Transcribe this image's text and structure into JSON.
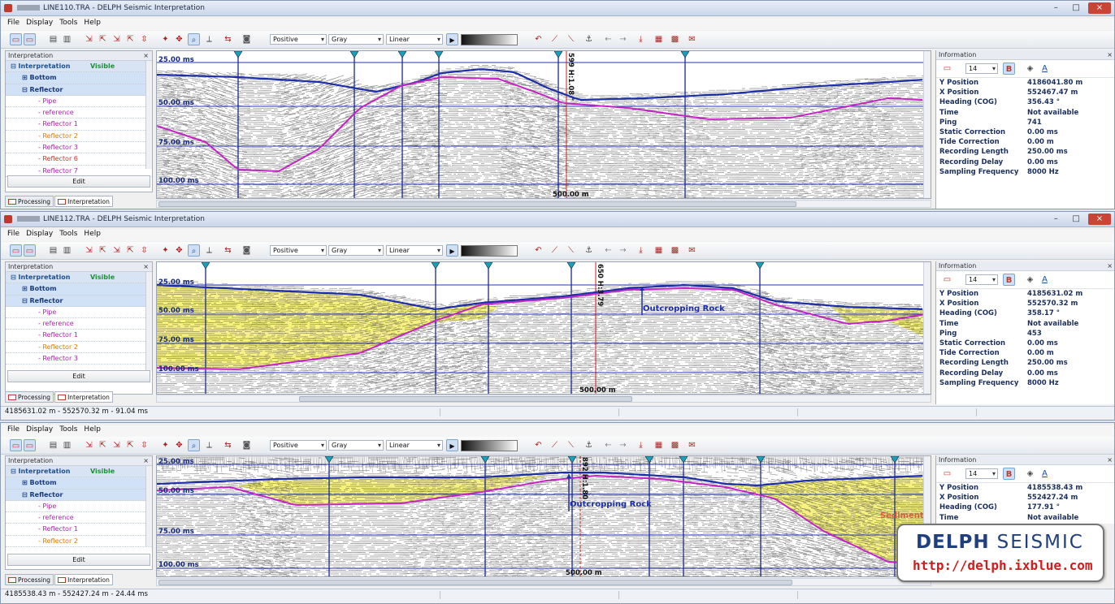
{
  "menu": [
    "File",
    "Display",
    "Tools",
    "Help"
  ],
  "toolbar_combos": {
    "polarity": "Positive",
    "palette": "Gray",
    "scale": "Linear"
  },
  "panel": {
    "interpretation_title": "Interpretation",
    "col_name": "Interpretation",
    "col_visible": "Visible",
    "edit_label": "Edit",
    "tab_processing": "Processing",
    "tab_interpretation": "Interpretation",
    "information_title": "Information",
    "font_size": "14",
    "info_bold": "B",
    "info_font_icon": "A",
    "close_glyph": "×"
  },
  "info_labels": [
    "Y Position",
    "X Position",
    "Heading (COG)",
    "Time",
    "Ping",
    "Static Correction",
    "Tide Correction",
    "Recording Length",
    "Recording Delay",
    "Sampling Frequency"
  ],
  "windows": [
    {
      "title": "LINE110.TRA - DELPH Seismic Interpretation",
      "tree": [
        {
          "label": "Bottom",
          "color": "#173a7a",
          "kind": "sel"
        },
        {
          "label": "Reflector",
          "color": "#173a7a",
          "kind": "sel"
        },
        {
          "label": "Pipe",
          "color": "#b01fb0"
        },
        {
          "label": "reference",
          "color": "#b01fb0"
        },
        {
          "label": "Reflector 1",
          "color": "#b01fb0"
        },
        {
          "label": "Reflector 2",
          "color": "#e07a00"
        },
        {
          "label": "Reflector 3",
          "color": "#b01fb0"
        },
        {
          "label": "Reflector 6",
          "color": "#c0392b"
        },
        {
          "label": "Reflector 7",
          "color": "#b01fb0"
        }
      ],
      "time_labels": [
        "25.00 ms",
        "50.00 ms",
        "75.00 ms",
        "100.00 ms"
      ],
      "distance_label": "500.00 m",
      "marker_label": "599 H:1.08 °",
      "info_values": [
        "4186041.80 m",
        "552467.47 m",
        "356.43 °",
        "Not available",
        "741",
        "0.00 ms",
        "0.00 m",
        "250.00 ms",
        "0.00 ms",
        "8000 Hz"
      ],
      "status": ""
    },
    {
      "title": "LINE112.TRA - DELPH Seismic Interpretation",
      "tree": [
        {
          "label": "Bottom",
          "color": "#173a7a",
          "kind": "sel"
        },
        {
          "label": "Reflector",
          "color": "#173a7a",
          "kind": "sel"
        },
        {
          "label": "Pipe",
          "color": "#b01fb0"
        },
        {
          "label": "reference",
          "color": "#b01fb0"
        },
        {
          "label": "Reflector 1",
          "color": "#b01fb0"
        },
        {
          "label": "Reflector 2",
          "color": "#e07a00"
        },
        {
          "label": "Reflector 3",
          "color": "#b01fb0"
        }
      ],
      "time_labels": [
        "25.00 ms",
        "50.00 ms",
        "75.00 ms",
        "100.00 ms"
      ],
      "distance_label": "500.00 m",
      "marker_label": "650 H:3.79",
      "annotation": "Outcropping Rock",
      "info_values": [
        "4185631.02 m",
        "552570.32 m",
        "358.17 °",
        "Not available",
        "453",
        "0.00 ms",
        "0.00 m",
        "250.00 ms",
        "0.00 ms",
        "8000 Hz"
      ],
      "status": "4185631.02 m - 552570.32 m - 91.04 ms"
    },
    {
      "title": "",
      "tree": [
        {
          "label": "Bottom",
          "color": "#173a7a",
          "kind": "sel"
        },
        {
          "label": "Reflector",
          "color": "#173a7a",
          "kind": "sel"
        },
        {
          "label": "Pipe",
          "color": "#b01fb0"
        },
        {
          "label": "reference",
          "color": "#b01fb0"
        },
        {
          "label": "Reflector 1",
          "color": "#b01fb0"
        },
        {
          "label": "Reflector 2",
          "color": "#e07a00"
        }
      ],
      "time_labels": [
        "25.00 ms",
        "50.00 ms",
        "75.00 ms",
        "100.00 ms"
      ],
      "distance_label": "500.00 m",
      "marker_label": "892 H:1.80",
      "annotation": "Outcropping Rock",
      "annotation2": "Sediment",
      "info_values": [
        "4185538.43 m",
        "552427.24 m",
        "177.91 °",
        "Not available"
      ],
      "status": "4185538.43 m - 552427.24 m - 24.44 ms"
    }
  ],
  "logo": {
    "brand": "DELPH",
    "brand2": "SEISMIC",
    "url": "http://delph.ixblue.com"
  },
  "colors": {
    "bottom_line": "#1c2fa8",
    "reflector_line": "#c623c6",
    "sediment_fill": "#f5ef6a",
    "marker_line": "#1a2a8c",
    "cursor_line": "#d01c1c"
  }
}
